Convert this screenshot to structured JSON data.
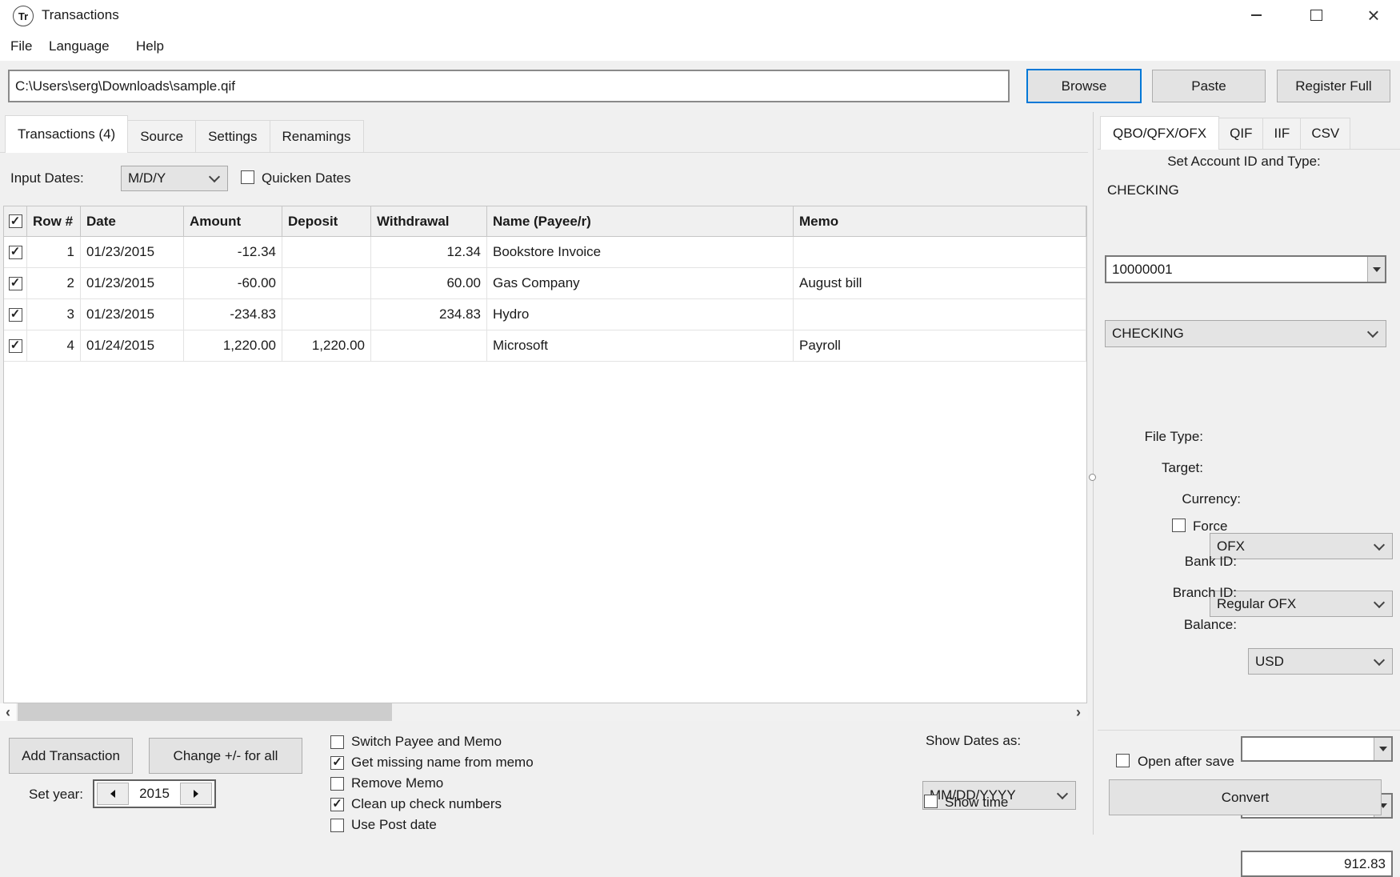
{
  "window": {
    "title": "Transactions",
    "icon_text": "Tr"
  },
  "icons": {
    "minimize": "–",
    "close": "×",
    "scroll_left": "‹",
    "scroll_right": "›"
  },
  "menu": {
    "items": [
      "File",
      "Language",
      "Help"
    ]
  },
  "toolbar": {
    "path_value": "C:\\Users\\serg\\Downloads\\sample.qif",
    "browse_label": "Browse",
    "paste_label": "Paste",
    "register_label": "Register Full"
  },
  "tabs": {
    "main": [
      {
        "label": "Transactions (4)",
        "active": true
      },
      {
        "label": "Source",
        "active": false
      },
      {
        "label": "Settings",
        "active": false
      },
      {
        "label": "Renamings",
        "active": false
      }
    ],
    "right": [
      {
        "label": "QBO/QFX/OFX",
        "active": true
      },
      {
        "label": "QIF",
        "active": false
      },
      {
        "label": "IIF",
        "active": false
      },
      {
        "label": "CSV",
        "active": false
      }
    ]
  },
  "filters": {
    "input_dates_label": "Input Dates:",
    "date_format": "M/D/Y",
    "quicken_label": "Quicken Dates",
    "quicken_checked": false
  },
  "table": {
    "header_checked": true,
    "columns": {
      "row": "Row #",
      "date": "Date",
      "amount": "Amount",
      "deposit": "Deposit",
      "withdrawal": "Withdrawal",
      "name": "Name (Payee/r)",
      "memo": "Memo"
    },
    "rows": [
      {
        "checked": true,
        "row": "1",
        "date": "01/23/2015",
        "amount": "-12.34",
        "deposit": "",
        "withdrawal": "12.34",
        "name": "Bookstore Invoice",
        "memo": ""
      },
      {
        "checked": true,
        "row": "2",
        "date": "01/23/2015",
        "amount": "-60.00",
        "deposit": "",
        "withdrawal": "60.00",
        "name": "Gas Company",
        "memo": "August bill"
      },
      {
        "checked": true,
        "row": "3",
        "date": "01/23/2015",
        "amount": "-234.83",
        "deposit": "",
        "withdrawal": "234.83",
        "name": "Hydro",
        "memo": ""
      },
      {
        "checked": true,
        "row": "4",
        "date": "01/24/2015",
        "amount": "1,220.00",
        "deposit": "1,220.00",
        "withdrawal": "",
        "name": "Microsoft",
        "memo": "Payroll"
      }
    ]
  },
  "bottom": {
    "add_label": "Add Transaction",
    "change_label": "Change +/- for all",
    "set_year_label": "Set year:",
    "year": "2015",
    "options": [
      {
        "label": "Switch Payee and Memo",
        "checked": false
      },
      {
        "label": "Get missing name from memo",
        "checked": true
      },
      {
        "label": "Remove Memo",
        "checked": false
      },
      {
        "label": "Clean up check numbers",
        "checked": true
      },
      {
        "label": "Use Post date",
        "checked": false
      }
    ],
    "show_dates_label": "Show Dates as:",
    "date_display": "MM/DD/YYYY",
    "show_time_label": "Show time",
    "show_time_checked": false
  },
  "panel": {
    "section_title": "Set Account ID and Type:",
    "account_name": "CHECKING",
    "account_id": "10000001",
    "account_type": "CHECKING",
    "file_type_label": "File Type:",
    "file_type": "OFX",
    "target_label": "Target:",
    "target": "Regular OFX",
    "currency_label": "Currency:",
    "currency": "USD",
    "force_label": "Force",
    "force_checked": false,
    "bank_id_label": "Bank ID:",
    "bank_id": "",
    "branch_id_label": "Branch ID:",
    "branch_id": "",
    "balance_label": "Balance:",
    "balance": "912.83",
    "open_label": "Open after save",
    "open_checked": false,
    "convert_label": "Convert"
  },
  "colors": {
    "accent_blue": "#0078d7",
    "button_face": "#e3e3e3",
    "window_bg": "#f0f0f0",
    "grid_line": "#e3e3e3"
  }
}
